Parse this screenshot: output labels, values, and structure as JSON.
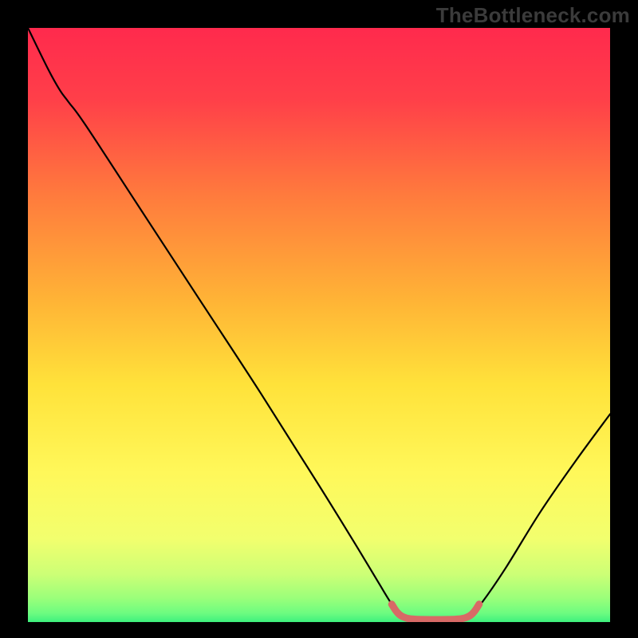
{
  "watermark": "TheBottleneck.com",
  "chart_data": {
    "type": "line",
    "title": "",
    "xlabel": "",
    "ylabel": "",
    "xrange": [
      0,
      100
    ],
    "yrange": [
      0,
      100
    ],
    "gradient_stops": [
      {
        "offset": 0.0,
        "color": "#ff2a4d"
      },
      {
        "offset": 0.12,
        "color": "#ff3f49"
      },
      {
        "offset": 0.28,
        "color": "#ff7a3d"
      },
      {
        "offset": 0.46,
        "color": "#ffb436"
      },
      {
        "offset": 0.6,
        "color": "#ffe23a"
      },
      {
        "offset": 0.75,
        "color": "#fff85a"
      },
      {
        "offset": 0.86,
        "color": "#f2ff6e"
      },
      {
        "offset": 0.92,
        "color": "#ccff76"
      },
      {
        "offset": 0.96,
        "color": "#9aff7a"
      },
      {
        "offset": 0.985,
        "color": "#6dfc80"
      },
      {
        "offset": 1.0,
        "color": "#3ef07e"
      }
    ],
    "series": [
      {
        "name": "curve",
        "stroke": "#000000",
        "stroke_width": 2.2,
        "points": [
          {
            "x": 0.0,
            "y": 100.0
          },
          {
            "x": 3.5,
            "y": 93.0
          },
          {
            "x": 5.5,
            "y": 89.5
          },
          {
            "x": 7.0,
            "y": 87.5
          },
          {
            "x": 10.0,
            "y": 83.5
          },
          {
            "x": 20.0,
            "y": 68.5
          },
          {
            "x": 30.0,
            "y": 53.5
          },
          {
            "x": 40.0,
            "y": 38.5
          },
          {
            "x": 50.0,
            "y": 23.0
          },
          {
            "x": 56.0,
            "y": 13.5
          },
          {
            "x": 60.0,
            "y": 7.0
          },
          {
            "x": 62.5,
            "y": 3.0
          },
          {
            "x": 64.0,
            "y": 1.2
          },
          {
            "x": 66.0,
            "y": 0.4
          },
          {
            "x": 70.0,
            "y": 0.3
          },
          {
            "x": 74.0,
            "y": 0.4
          },
          {
            "x": 76.0,
            "y": 1.2
          },
          {
            "x": 78.0,
            "y": 3.3
          },
          {
            "x": 82.0,
            "y": 9.0
          },
          {
            "x": 88.0,
            "y": 18.5
          },
          {
            "x": 94.0,
            "y": 27.0
          },
          {
            "x": 100.0,
            "y": 35.0
          }
        ]
      },
      {
        "name": "highlight",
        "stroke": "#d86a66",
        "stroke_width": 9,
        "linecap": "round",
        "points": [
          {
            "x": 62.5,
            "y": 3.0
          },
          {
            "x": 63.3,
            "y": 1.8
          },
          {
            "x": 64.2,
            "y": 1.0
          },
          {
            "x": 66.0,
            "y": 0.5
          },
          {
            "x": 70.0,
            "y": 0.4
          },
          {
            "x": 74.0,
            "y": 0.5
          },
          {
            "x": 75.8,
            "y": 1.0
          },
          {
            "x": 76.7,
            "y": 1.8
          },
          {
            "x": 77.5,
            "y": 3.0
          }
        ]
      }
    ]
  }
}
